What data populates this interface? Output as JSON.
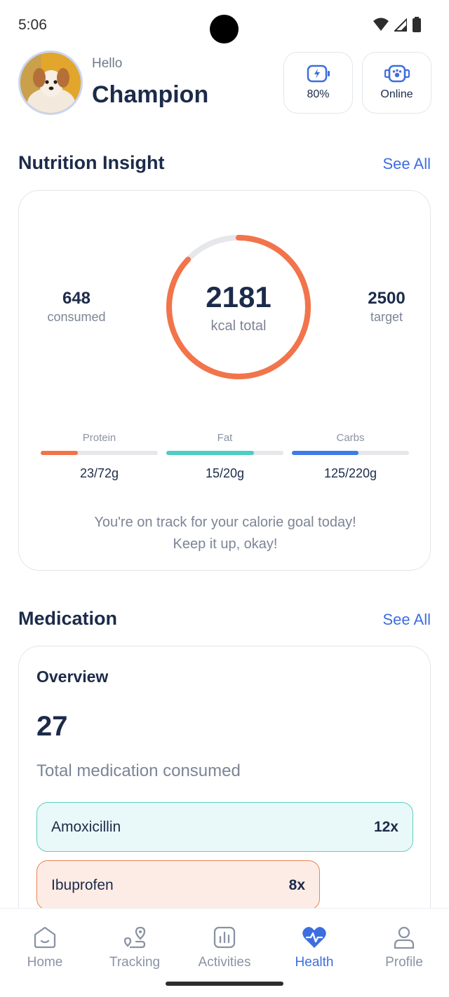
{
  "status_bar": {
    "time": "5:06"
  },
  "header": {
    "greeting": "Hello",
    "name": "Champion",
    "battery_label": "80%",
    "connection_label": "Online"
  },
  "nutrition": {
    "section_title": "Nutrition Insight",
    "see_all": "See All",
    "consumed_value": "648",
    "consumed_label": "consumed",
    "total_value": "2181",
    "total_label": "kcal total",
    "target_value": "2500",
    "target_label": "target",
    "ring_progress": 0.87,
    "macros": [
      {
        "label": "Protein",
        "value": "23/72g",
        "progress": 0.32,
        "color": "#f2744a"
      },
      {
        "label": "Fat",
        "value": "15/20g",
        "progress": 0.75,
        "color": "#4ecdc4"
      },
      {
        "label": "Carbs",
        "value": "125/220g",
        "progress": 0.57,
        "color": "#3f7be8"
      }
    ],
    "note_line1": "You're on track for your calorie goal today!",
    "note_line2": "Keep it up, okay!"
  },
  "medication": {
    "section_title": "Medication",
    "see_all": "See All",
    "overview_title": "Overview",
    "total_count": "27",
    "total_label": "Total medication consumed",
    "items": [
      {
        "name": "Amoxicillin",
        "count": "12x"
      },
      {
        "name": "Ibuprofen",
        "count": "8x"
      }
    ]
  },
  "nav": {
    "items": [
      {
        "label": "Home",
        "icon": "home-icon"
      },
      {
        "label": "Tracking",
        "icon": "tracking-icon"
      },
      {
        "label": "Activities",
        "icon": "activities-icon"
      },
      {
        "label": "Health",
        "icon": "heart-icon"
      },
      {
        "label": "Profile",
        "icon": "profile-icon"
      }
    ],
    "active_index": 3
  },
  "colors": {
    "accent": "#3d6ee0",
    "ring": "#f2744a",
    "ring_track": "#e6e7ea",
    "text_dark": "#1c2b4a"
  }
}
